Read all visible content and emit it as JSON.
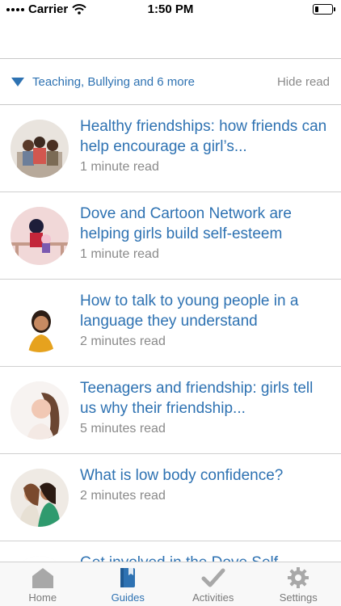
{
  "status": {
    "carrier": "Carrier",
    "time": "1:50 PM",
    "battery_level": 0.2
  },
  "filter": {
    "label": "Teaching, Bullying and 6 more",
    "hide_read": "Hide read"
  },
  "articles": [
    {
      "title": "Healthy friendships: how friends can help encourage a girl’s...",
      "read_time": "1 minute read"
    },
    {
      "title": "Dove and Cartoon Network are helping girls build self-esteem",
      "read_time": "1 minute read"
    },
    {
      "title": "How to talk to young people in a language they understand",
      "read_time": "2 minutes read"
    },
    {
      "title": "Teenagers and friendship: girls tell us why their friendship...",
      "read_time": "5 minutes read"
    },
    {
      "title": "What is low body confidence?",
      "read_time": "2 minutes read"
    },
    {
      "title": "Get involved in the Dove Self",
      "read_time": ""
    }
  ],
  "tabs": {
    "home": "Home",
    "guides": "Guides",
    "activities": "Activities",
    "settings": "Settings"
  },
  "colors": {
    "accent": "#2e72b2",
    "muted": "#8a8a8a",
    "tab_inactive": "#a8a8a8"
  }
}
